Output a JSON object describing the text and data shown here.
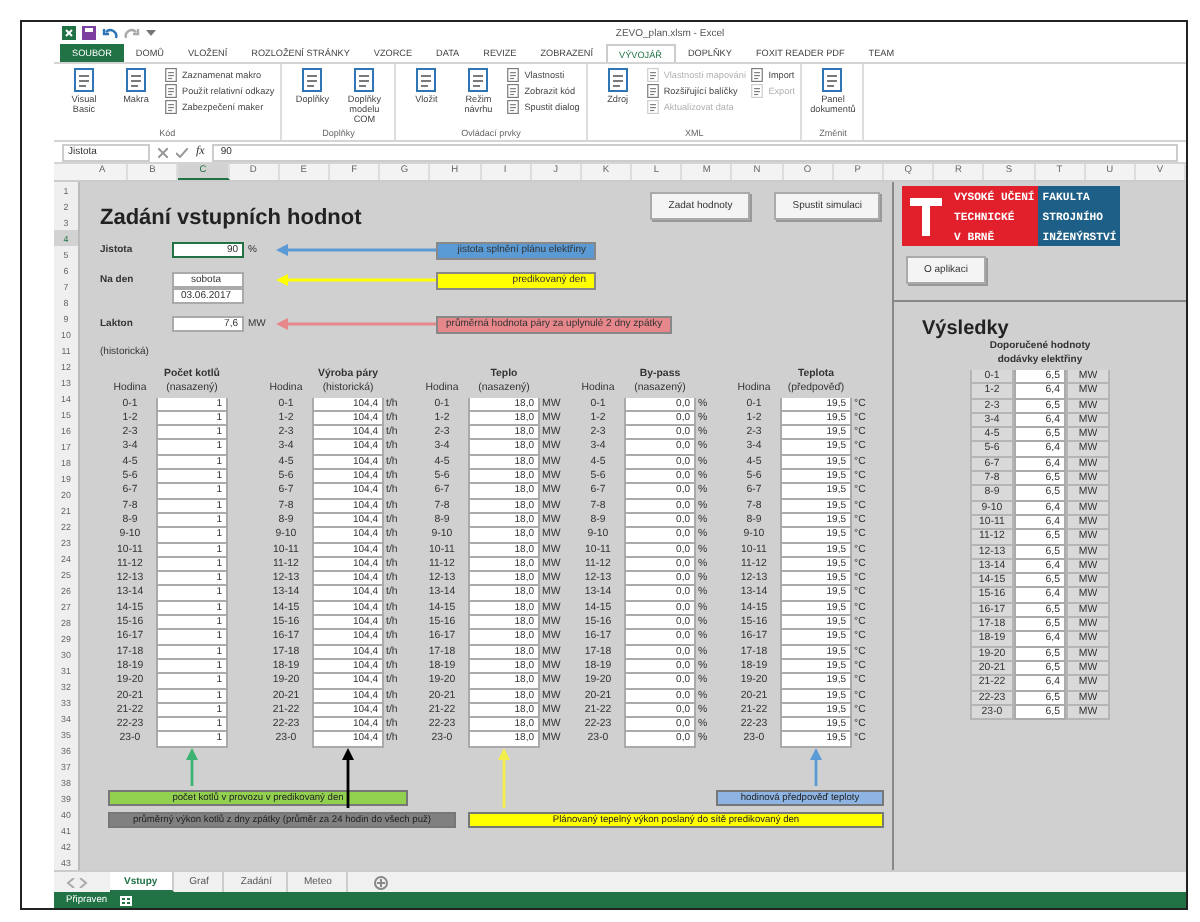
{
  "window": {
    "title": "ZEVO_plan.xlsm - Excel"
  },
  "ribbon": {
    "tabs": [
      {
        "label": "SOUBOR",
        "kind": "file",
        "selected": false
      },
      {
        "label": "DOMŮ",
        "kind": "tab",
        "selected": false
      },
      {
        "label": "VLOŽENÍ",
        "kind": "tab",
        "selected": false
      },
      {
        "label": "ROZLOŽENÍ STRÁNKY",
        "kind": "tab",
        "selected": false
      },
      {
        "label": "VZORCE",
        "kind": "tab",
        "selected": false
      },
      {
        "label": "DATA",
        "kind": "tab",
        "selected": false
      },
      {
        "label": "REVIZE",
        "kind": "tab",
        "selected": false
      },
      {
        "label": "ZOBRAZENÍ",
        "kind": "tab",
        "selected": false
      },
      {
        "label": "VÝVOJÁŘ",
        "kind": "tab",
        "selected": true
      },
      {
        "label": "DOPLŇKY",
        "kind": "tab",
        "selected": false
      },
      {
        "label": "FOXIT READER PDF",
        "kind": "tab",
        "selected": false
      },
      {
        "label": "TEAM",
        "kind": "tab",
        "selected": false
      }
    ],
    "groups": [
      {
        "name": "Kód",
        "items": [
          {
            "kind": "large",
            "label": "Visual Basic",
            "disabled": false
          },
          {
            "kind": "large",
            "label": "Makra",
            "disabled": false
          },
          {
            "kind": "small",
            "label": "Zaznamenat makro",
            "disabled": false
          },
          {
            "kind": "small",
            "label": "Použít relativní odkazy",
            "disabled": false
          },
          {
            "kind": "small",
            "label": "Zabezpečení maker",
            "disabled": false
          }
        ]
      },
      {
        "name": "Doplňky",
        "items": [
          {
            "kind": "large",
            "label": "Doplňky",
            "disabled": false
          },
          {
            "kind": "large",
            "label": "Doplňky modelu COM",
            "disabled": false
          }
        ]
      },
      {
        "name": "Ovládací prvky",
        "items": [
          {
            "kind": "large",
            "label": "Vložit",
            "disabled": false
          },
          {
            "kind": "large",
            "label": "Režim návrhu",
            "disabled": false
          },
          {
            "kind": "small",
            "label": "Vlastnosti",
            "disabled": false
          },
          {
            "kind": "small",
            "label": "Zobrazit kód",
            "disabled": false
          },
          {
            "kind": "small",
            "label": "Spustit dialog",
            "disabled": false
          }
        ]
      },
      {
        "name": "XML",
        "items": [
          {
            "kind": "large",
            "label": "Zdroj",
            "disabled": false
          },
          {
            "kind": "small",
            "label": "Vlastnosti mapování",
            "disabled": true
          },
          {
            "kind": "small",
            "label": "Rozšiřující balíčky",
            "disabled": false
          },
          {
            "kind": "small",
            "label": "Aktualizovat data",
            "disabled": true
          },
          {
            "kind": "small",
            "label": "Import",
            "disabled": false
          },
          {
            "kind": "small",
            "label": "Export",
            "disabled": true
          }
        ]
      },
      {
        "name": "Změnit",
        "items": [
          {
            "kind": "large",
            "label": "Panel dokumentů",
            "disabled": false
          }
        ]
      }
    ]
  },
  "formula_bar": {
    "name_box": "Jistota",
    "function_label": "fx",
    "value": "90"
  },
  "column_headers": [
    {
      "label": "A",
      "selected": false
    },
    {
      "label": "B",
      "selected": false
    },
    {
      "label": "C",
      "selected": true
    },
    {
      "label": "D",
      "selected": false
    },
    {
      "label": "E",
      "selected": false
    },
    {
      "label": "F",
      "selected": false
    },
    {
      "label": "G",
      "selected": false
    },
    {
      "label": "H",
      "selected": false
    },
    {
      "label": "I",
      "selected": false
    },
    {
      "label": "J",
      "selected": false
    },
    {
      "label": "K",
      "selected": false
    },
    {
      "label": "L",
      "selected": false
    },
    {
      "label": "M",
      "selected": false
    },
    {
      "label": "N",
      "selected": false
    },
    {
      "label": "O",
      "selected": false
    },
    {
      "label": "P",
      "selected": false
    },
    {
      "label": "Q",
      "selected": false
    },
    {
      "label": "R",
      "selected": false
    },
    {
      "label": "S",
      "selected": false
    },
    {
      "label": "T",
      "selected": false
    },
    {
      "label": "U",
      "selected": false
    },
    {
      "label": "V",
      "selected": false
    }
  ],
  "row_headers": [
    {
      "label": "1",
      "selected": false
    },
    {
      "label": "2",
      "selected": false
    },
    {
      "label": "3",
      "selected": false
    },
    {
      "label": "4",
      "selected": true
    },
    {
      "label": "5",
      "selected": false
    },
    {
      "label": "6",
      "selected": false
    },
    {
      "label": "7",
      "selected": false
    },
    {
      "label": "8",
      "selected": false
    },
    {
      "label": "9",
      "selected": false
    },
    {
      "label": "10",
      "selected": false
    },
    {
      "label": "11",
      "selected": false
    },
    {
      "label": "12",
      "selected": false
    },
    {
      "label": "13",
      "selected": false
    },
    {
      "label": "14",
      "selected": false
    },
    {
      "label": "15",
      "selected": false
    },
    {
      "label": "16",
      "selected": false
    },
    {
      "label": "17",
      "selected": false
    },
    {
      "label": "18",
      "selected": false
    },
    {
      "label": "19",
      "selected": false
    },
    {
      "label": "20",
      "selected": false
    },
    {
      "label": "21",
      "selected": false
    },
    {
      "label": "22",
      "selected": false
    },
    {
      "label": "23",
      "selected": false
    },
    {
      "label": "24",
      "selected": false
    },
    {
      "label": "25",
      "selected": false
    },
    {
      "label": "26",
      "selected": false
    },
    {
      "label": "27",
      "selected": false
    },
    {
      "label": "28",
      "selected": false
    },
    {
      "label": "29",
      "selected": false
    },
    {
      "label": "30",
      "selected": false
    },
    {
      "label": "31",
      "selected": false
    },
    {
      "label": "32",
      "selected": false
    },
    {
      "label": "33",
      "selected": false
    },
    {
      "label": "34",
      "selected": false
    },
    {
      "label": "35",
      "selected": false
    },
    {
      "label": "36",
      "selected": false
    },
    {
      "label": "37",
      "selected": false
    },
    {
      "label": "38",
      "selected": false
    },
    {
      "label": "39",
      "selected": false
    },
    {
      "label": "40",
      "selected": false
    },
    {
      "label": "41",
      "selected": false
    },
    {
      "label": "42",
      "selected": false
    },
    {
      "label": "43",
      "selected": false
    }
  ],
  "sheet": {
    "title": "Zadání vstupních hodnot",
    "buttons": [
      "Zadat hodnoty",
      "Spustit simulaci"
    ],
    "inputs": [
      {
        "label": "Jistota",
        "value": "90",
        "unit": "%",
        "note": "jistota splnění plánu elektřiny",
        "color": "#5b9bd5",
        "selected": true
      },
      {
        "label": "Na den",
        "value": "sobota",
        "date": "03.06.2017",
        "note": "predikovaný den",
        "color": "#ffff00",
        "selected": false
      },
      {
        "label": "Lakton",
        "value": "7,6",
        "unit": "MW",
        "note": "průměrná hodnota páry za uplynulé 2 dny zpátky",
        "color": "#e6878b",
        "selected": false
      }
    ],
    "historical_note": "(historická)",
    "table": {
      "columns": [
        {
          "title": "Počet kotlů",
          "subtitle": "(nasazený)",
          "hour_label": "Hodina",
          "rows": [
            {
              "hour": "0-1",
              "value": "1"
            },
            {
              "hour": "1-2",
              "value": "1"
            },
            {
              "hour": "2-3",
              "value": "1"
            },
            {
              "hour": "3-4",
              "value": "1"
            },
            {
              "hour": "4-5",
              "value": "1"
            },
            {
              "hour": "5-6",
              "value": "1"
            },
            {
              "hour": "6-7",
              "value": "1"
            },
            {
              "hour": "7-8",
              "value": "1"
            },
            {
              "hour": "8-9",
              "value": "1"
            },
            {
              "hour": "9-10",
              "value": "1"
            },
            {
              "hour": "10-11",
              "value": "1"
            },
            {
              "hour": "11-12",
              "value": "1"
            },
            {
              "hour": "12-13",
              "value": "1"
            },
            {
              "hour": "13-14",
              "value": "1"
            },
            {
              "hour": "14-15",
              "value": "1"
            },
            {
              "hour": "15-16",
              "value": "1"
            },
            {
              "hour": "16-17",
              "value": "1"
            },
            {
              "hour": "17-18",
              "value": "1"
            },
            {
              "hour": "18-19",
              "value": "1"
            },
            {
              "hour": "19-20",
              "value": "1"
            },
            {
              "hour": "20-21",
              "value": "1"
            },
            {
              "hour": "21-22",
              "value": "1"
            },
            {
              "hour": "22-23",
              "value": "1"
            },
            {
              "hour": "23-0",
              "value": "1"
            }
          ]
        },
        {
          "title": "Výroba páry",
          "subtitle": "(historická)",
          "hour_label": "Hodina",
          "rows": [
            {
              "hour": "0-1",
              "value": "104,4",
              "unit": "t/h"
            },
            {
              "hour": "1-2",
              "value": "104,4",
              "unit": "t/h"
            },
            {
              "hour": "2-3",
              "value": "104,4",
              "unit": "t/h"
            },
            {
              "hour": "3-4",
              "value": "104,4",
              "unit": "t/h"
            },
            {
              "hour": "4-5",
              "value": "104,4",
              "unit": "t/h"
            },
            {
              "hour": "5-6",
              "value": "104,4",
              "unit": "t/h"
            },
            {
              "hour": "6-7",
              "value": "104,4",
              "unit": "t/h"
            },
            {
              "hour": "7-8",
              "value": "104,4",
              "unit": "t/h"
            },
            {
              "hour": "8-9",
              "value": "104,4",
              "unit": "t/h"
            },
            {
              "hour": "9-10",
              "value": "104,4",
              "unit": "t/h"
            },
            {
              "hour": "10-11",
              "value": "104,4",
              "unit": "t/h"
            },
            {
              "hour": "11-12",
              "value": "104,4",
              "unit": "t/h"
            },
            {
              "hour": "12-13",
              "value": "104,4",
              "unit": "t/h"
            },
            {
              "hour": "13-14",
              "value": "104,4",
              "unit": "t/h"
            },
            {
              "hour": "14-15",
              "value": "104,4",
              "unit": "t/h"
            },
            {
              "hour": "15-16",
              "value": "104,4",
              "unit": "t/h"
            },
            {
              "hour": "16-17",
              "value": "104,4",
              "unit": "t/h"
            },
            {
              "hour": "17-18",
              "value": "104,4",
              "unit": "t/h"
            },
            {
              "hour": "18-19",
              "value": "104,4",
              "unit": "t/h"
            },
            {
              "hour": "19-20",
              "value": "104,4",
              "unit": "t/h"
            },
            {
              "hour": "20-21",
              "value": "104,4",
              "unit": "t/h"
            },
            {
              "hour": "21-22",
              "value": "104,4",
              "unit": "t/h"
            },
            {
              "hour": "22-23",
              "value": "104,4",
              "unit": "t/h"
            },
            {
              "hour": "23-0",
              "value": "104,4",
              "unit": "t/h"
            }
          ]
        },
        {
          "title": "Teplo",
          "subtitle": "(nasazený)",
          "hour_label": "Hodina",
          "rows": [
            {
              "hour": "0-1",
              "value": "18,0",
              "unit": "MW"
            },
            {
              "hour": "1-2",
              "value": "18,0",
              "unit": "MW"
            },
            {
              "hour": "2-3",
              "value": "18,0",
              "unit": "MW"
            },
            {
              "hour": "3-4",
              "value": "18,0",
              "unit": "MW"
            },
            {
              "hour": "4-5",
              "value": "18,0",
              "unit": "MW"
            },
            {
              "hour": "5-6",
              "value": "18,0",
              "unit": "MW"
            },
            {
              "hour": "6-7",
              "value": "18,0",
              "unit": "MW"
            },
            {
              "hour": "7-8",
              "value": "18,0",
              "unit": "MW"
            },
            {
              "hour": "8-9",
              "value": "18,0",
              "unit": "MW"
            },
            {
              "hour": "9-10",
              "value": "18,0",
              "unit": "MW"
            },
            {
              "hour": "10-11",
              "value": "18,0",
              "unit": "MW"
            },
            {
              "hour": "11-12",
              "value": "18,0",
              "unit": "MW"
            },
            {
              "hour": "12-13",
              "value": "18,0",
              "unit": "MW"
            },
            {
              "hour": "13-14",
              "value": "18,0",
              "unit": "MW"
            },
            {
              "hour": "14-15",
              "value": "18,0",
              "unit": "MW"
            },
            {
              "hour": "15-16",
              "value": "18,0",
              "unit": "MW"
            },
            {
              "hour": "16-17",
              "value": "18,0",
              "unit": "MW"
            },
            {
              "hour": "17-18",
              "value": "18,0",
              "unit": "MW"
            },
            {
              "hour": "18-19",
              "value": "18,0",
              "unit": "MW"
            },
            {
              "hour": "19-20",
              "value": "18,0",
              "unit": "MW"
            },
            {
              "hour": "20-21",
              "value": "18,0",
              "unit": "MW"
            },
            {
              "hour": "21-22",
              "value": "18,0",
              "unit": "MW"
            },
            {
              "hour": "22-23",
              "value": "18,0",
              "unit": "MW"
            },
            {
              "hour": "23-0",
              "value": "18,0",
              "unit": "MW"
            }
          ]
        },
        {
          "title": "By-pass",
          "subtitle": "(nasazený)",
          "hour_label": "Hodina",
          "rows": [
            {
              "hour": "0-1",
              "value": "0,0",
              "unit": "%"
            },
            {
              "hour": "1-2",
              "value": "0,0",
              "unit": "%"
            },
            {
              "hour": "2-3",
              "value": "0,0",
              "unit": "%"
            },
            {
              "hour": "3-4",
              "value": "0,0",
              "unit": "%"
            },
            {
              "hour": "4-5",
              "value": "0,0",
              "unit": "%"
            },
            {
              "hour": "5-6",
              "value": "0,0",
              "unit": "%"
            },
            {
              "hour": "6-7",
              "value": "0,0",
              "unit": "%"
            },
            {
              "hour": "7-8",
              "value": "0,0",
              "unit": "%"
            },
            {
              "hour": "8-9",
              "value": "0,0",
              "unit": "%"
            },
            {
              "hour": "9-10",
              "value": "0,0",
              "unit": "%"
            },
            {
              "hour": "10-11",
              "value": "0,0",
              "unit": "%"
            },
            {
              "hour": "11-12",
              "value": "0,0",
              "unit": "%"
            },
            {
              "hour": "12-13",
              "value": "0,0",
              "unit": "%"
            },
            {
              "hour": "13-14",
              "value": "0,0",
              "unit": "%"
            },
            {
              "hour": "14-15",
              "value": "0,0",
              "unit": "%"
            },
            {
              "hour": "15-16",
              "value": "0,0",
              "unit": "%"
            },
            {
              "hour": "16-17",
              "value": "0,0",
              "unit": "%"
            },
            {
              "hour": "17-18",
              "value": "0,0",
              "unit": "%"
            },
            {
              "hour": "18-19",
              "value": "0,0",
              "unit": "%"
            },
            {
              "hour": "19-20",
              "value": "0,0",
              "unit": "%"
            },
            {
              "hour": "20-21",
              "value": "0,0",
              "unit": "%"
            },
            {
              "hour": "21-22",
              "value": "0,0",
              "unit": "%"
            },
            {
              "hour": "22-23",
              "value": "0,0",
              "unit": "%"
            },
            {
              "hour": "23-0",
              "value": "0,0",
              "unit": "%"
            }
          ]
        },
        {
          "title": "Teplota",
          "subtitle": "(předpověď)",
          "hour_label": "Hodina",
          "rows": [
            {
              "hour": "0-1",
              "value": "19,5",
              "unit": "°C"
            },
            {
              "hour": "1-2",
              "value": "19,5",
              "unit": "°C"
            },
            {
              "hour": "2-3",
              "value": "19,5",
              "unit": "°C"
            },
            {
              "hour": "3-4",
              "value": "19,5",
              "unit": "°C"
            },
            {
              "hour": "4-5",
              "value": "19,5",
              "unit": "°C"
            },
            {
              "hour": "5-6",
              "value": "19,5",
              "unit": "°C"
            },
            {
              "hour": "6-7",
              "value": "19,5",
              "unit": "°C"
            },
            {
              "hour": "7-8",
              "value": "19,5",
              "unit": "°C"
            },
            {
              "hour": "8-9",
              "value": "19,5",
              "unit": "°C"
            },
            {
              "hour": "9-10",
              "value": "19,5",
              "unit": "°C"
            },
            {
              "hour": "10-11",
              "value": "19,5",
              "unit": "°C"
            },
            {
              "hour": "11-12",
              "value": "19,5",
              "unit": "°C"
            },
            {
              "hour": "12-13",
              "value": "19,5",
              "unit": "°C"
            },
            {
              "hour": "13-14",
              "value": "19,5",
              "unit": "°C"
            },
            {
              "hour": "14-15",
              "value": "19,5",
              "unit": "°C"
            },
            {
              "hour": "15-16",
              "value": "19,5",
              "unit": "°C"
            },
            {
              "hour": "16-17",
              "value": "19,5",
              "unit": "°C"
            },
            {
              "hour": "17-18",
              "value": "19,5",
              "unit": "°C"
            },
            {
              "hour": "18-19",
              "value": "19,5",
              "unit": "°C"
            },
            {
              "hour": "19-20",
              "value": "19,5",
              "unit": "°C"
            },
            {
              "hour": "20-21",
              "value": "19,5",
              "unit": "°C"
            },
            {
              "hour": "21-22",
              "value": "19,5",
              "unit": "°C"
            },
            {
              "hour": "22-23",
              "value": "19,5",
              "unit": "°C"
            },
            {
              "hour": "23-0",
              "value": "19,5",
              "unit": "°C"
            }
          ]
        }
      ]
    },
    "annotations": [
      {
        "text": "počet kotlů v provozu v predikovaný den",
        "color": "#92d050",
        "arrow": {
          "color": "#3cb371"
        }
      },
      {
        "text": "hodinová předpověď teploty",
        "color": "#8db4e2",
        "arrow": {
          "color": "#5b9bd5"
        }
      },
      {
        "text": "průměrný výkon kotlů z dny zpátky (průměr za 24 hodin do všech puž)",
        "color": "#808080",
        "arrow": {
          "color": "#000000"
        }
      },
      {
        "text": "Plánovaný tepelný výkon poslaný do sítě predikovaný den",
        "color": "#ffff00",
        "arrow": {
          "color": "#f2ef4a"
        }
      }
    ]
  },
  "results_panel": {
    "logo": {
      "lines": [
        {
          "left": "VYSOKÉ UČENÍ",
          "right": "FAKULTA"
        },
        {
          "left": "TECHNICKÉ",
          "right": "STROJNÍHO"
        },
        {
          "left": "V BRNĚ",
          "right": "INŽENÝRSTVÍ"
        }
      ]
    },
    "about_button": "O aplikaci",
    "title": "Výsledky",
    "header": [
      "Doporučené hodnoty",
      "dodávky elektřiny"
    ],
    "rows": [
      {
        "hour": "0-1",
        "value": "6,5",
        "unit": "MW"
      },
      {
        "hour": "1-2",
        "value": "6,4",
        "unit": "MW"
      },
      {
        "hour": "2-3",
        "value": "6,5",
        "unit": "MW"
      },
      {
        "hour": "3-4",
        "value": "6,4",
        "unit": "MW"
      },
      {
        "hour": "4-5",
        "value": "6,5",
        "unit": "MW"
      },
      {
        "hour": "5-6",
        "value": "6,4",
        "unit": "MW"
      },
      {
        "hour": "6-7",
        "value": "6,4",
        "unit": "MW"
      },
      {
        "hour": "7-8",
        "value": "6,5",
        "unit": "MW"
      },
      {
        "hour": "8-9",
        "value": "6,5",
        "unit": "MW"
      },
      {
        "hour": "9-10",
        "value": "6,4",
        "unit": "MW"
      },
      {
        "hour": "10-11",
        "value": "6,4",
        "unit": "MW"
      },
      {
        "hour": "11-12",
        "value": "6,5",
        "unit": "MW"
      },
      {
        "hour": "12-13",
        "value": "6,5",
        "unit": "MW"
      },
      {
        "hour": "13-14",
        "value": "6,4",
        "unit": "MW"
      },
      {
        "hour": "14-15",
        "value": "6,5",
        "unit": "MW"
      },
      {
        "hour": "15-16",
        "value": "6,4",
        "unit": "MW"
      },
      {
        "hour": "16-17",
        "value": "6,5",
        "unit": "MW"
      },
      {
        "hour": "17-18",
        "value": "6,5",
        "unit": "MW"
      },
      {
        "hour": "18-19",
        "value": "6,4",
        "unit": "MW"
      },
      {
        "hour": "19-20",
        "value": "6,5",
        "unit": "MW"
      },
      {
        "hour": "20-21",
        "value": "6,5",
        "unit": "MW"
      },
      {
        "hour": "21-22",
        "value": "6,4",
        "unit": "MW"
      },
      {
        "hour": "22-23",
        "value": "6,5",
        "unit": "MW"
      },
      {
        "hour": "23-0",
        "value": "6,5",
        "unit": "MW"
      }
    ]
  },
  "sheet_tabs": [
    {
      "label": "Vstupy",
      "selected": true
    },
    {
      "label": "Graf",
      "selected": false
    },
    {
      "label": "Zadání",
      "selected": false
    },
    {
      "label": "Meteo",
      "selected": false
    }
  ],
  "status_bar": {
    "text": "Připraven"
  }
}
